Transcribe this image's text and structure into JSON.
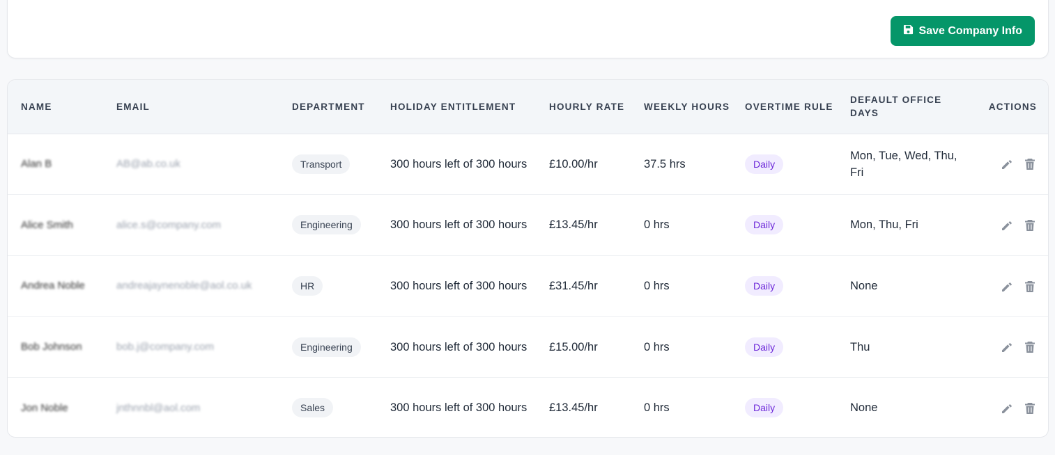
{
  "toolbar": {
    "save_label": "Save Company Info"
  },
  "table": {
    "headers": {
      "name": "NAME",
      "email": "EMAIL",
      "department": "DEPARTMENT",
      "holiday": "HOLIDAY ENTITLEMENT",
      "rate": "HOURLY RATE",
      "weekly": "WEEKLY HOURS",
      "overtime": "OVERTIME RULE",
      "office_days": "DEFAULT OFFICE DAYS",
      "actions": "ACTIONS"
    },
    "rows": [
      {
        "name": "Alan B",
        "email": "AB@ab.co.uk",
        "department": "Transport",
        "holiday": "300 hours left of 300 hours",
        "rate": "£10.00/hr",
        "weekly": "37.5 hrs",
        "overtime": "Daily",
        "office_days": "Mon, Tue, Wed, Thu, Fri"
      },
      {
        "name": "Alice Smith",
        "email": "alice.s@company.com",
        "department": "Engineering",
        "holiday": "300 hours left of 300 hours",
        "rate": "£13.45/hr",
        "weekly": "0 hrs",
        "overtime": "Daily",
        "office_days": "Mon, Thu, Fri"
      },
      {
        "name": "Andrea Noble",
        "email": "andreajaynenoble@aol.co.uk",
        "department": "HR",
        "holiday": "300 hours left of 300 hours",
        "rate": "£31.45/hr",
        "weekly": "0 hrs",
        "overtime": "Daily",
        "office_days": "None"
      },
      {
        "name": "Bob Johnson",
        "email": "bob.j@company.com",
        "department": "Engineering",
        "holiday": "300 hours left of 300 hours",
        "rate": "£15.00/hr",
        "weekly": "0 hrs",
        "overtime": "Daily",
        "office_days": "Thu"
      },
      {
        "name": "Jon Noble",
        "email": "jnthnnbl@aol.com",
        "department": "Sales",
        "holiday": "300 hours left of 300 hours",
        "rate": "£13.45/hr",
        "weekly": "0 hrs",
        "overtime": "Daily",
        "office_days": "None"
      }
    ]
  },
  "icons": {
    "save": "floppy-disk-icon",
    "edit": "pencil-icon",
    "delete": "trash-icon"
  },
  "colors": {
    "accent": "#059669",
    "badge_daily": "#6d28d9"
  }
}
